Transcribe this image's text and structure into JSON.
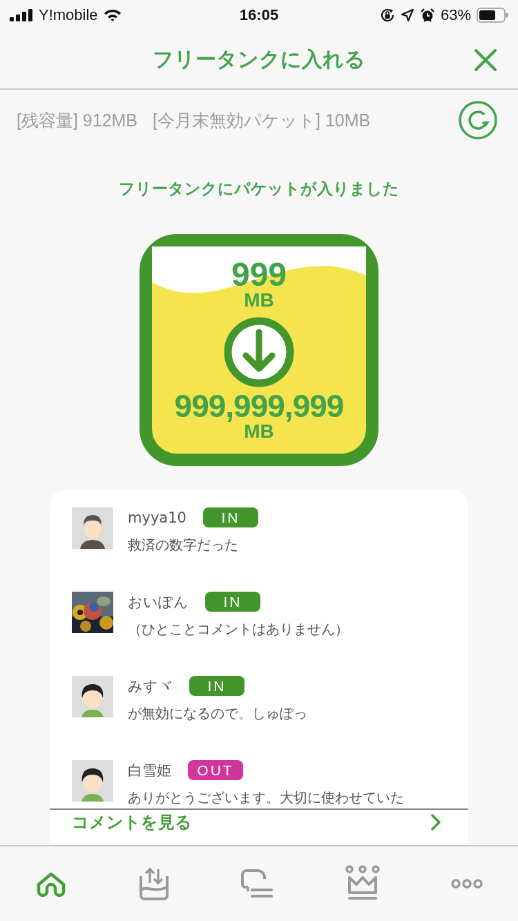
{
  "status_bar": {
    "carrier": "Y!mobile",
    "time": "16:05",
    "battery": "63%"
  },
  "header": {
    "title": "フリータンクに入れる"
  },
  "info": {
    "remaining": "[残容量] 912MB",
    "expiring": "[今月末無効パケット] 10MB"
  },
  "message": "フリータンクにパケットが入りました",
  "tank": {
    "added": "999",
    "added_unit": "MB",
    "total": "999,999,999",
    "total_unit": "MB"
  },
  "comments": [
    {
      "avatar": {
        "kind": "man"
      },
      "name": "myya10",
      "badge": {
        "kind": "in",
        "label": "IN"
      },
      "text": "救済の数字だった"
    },
    {
      "name": "おいぽん",
      "badge": {
        "kind": "in",
        "label": "IN"
      },
      "text": "（ひとことコメントはありません）"
    },
    {
      "avatar": {
        "kind": "woman"
      },
      "name": "みすヾ",
      "badge": {
        "kind": "in",
        "label": "IN"
      },
      "text": "が無効になるので。しゅぽっ"
    },
    {
      "avatar": {
        "kind": "woman"
      },
      "name": "白雪姫",
      "badge": {
        "kind": "out",
        "label": "OUT"
      },
      "text": "ありがとうございます。大切に使わせていた"
    }
  ],
  "more_link": "コメントを見る",
  "tabs": [
    {
      "kind": "home",
      "selected": true
    },
    {
      "kind": "tank",
      "selected": false
    },
    {
      "kind": "chat",
      "selected": false
    },
    {
      "kind": "crown",
      "selected": false
    },
    {
      "kind": "more",
      "selected": false
    }
  ]
}
